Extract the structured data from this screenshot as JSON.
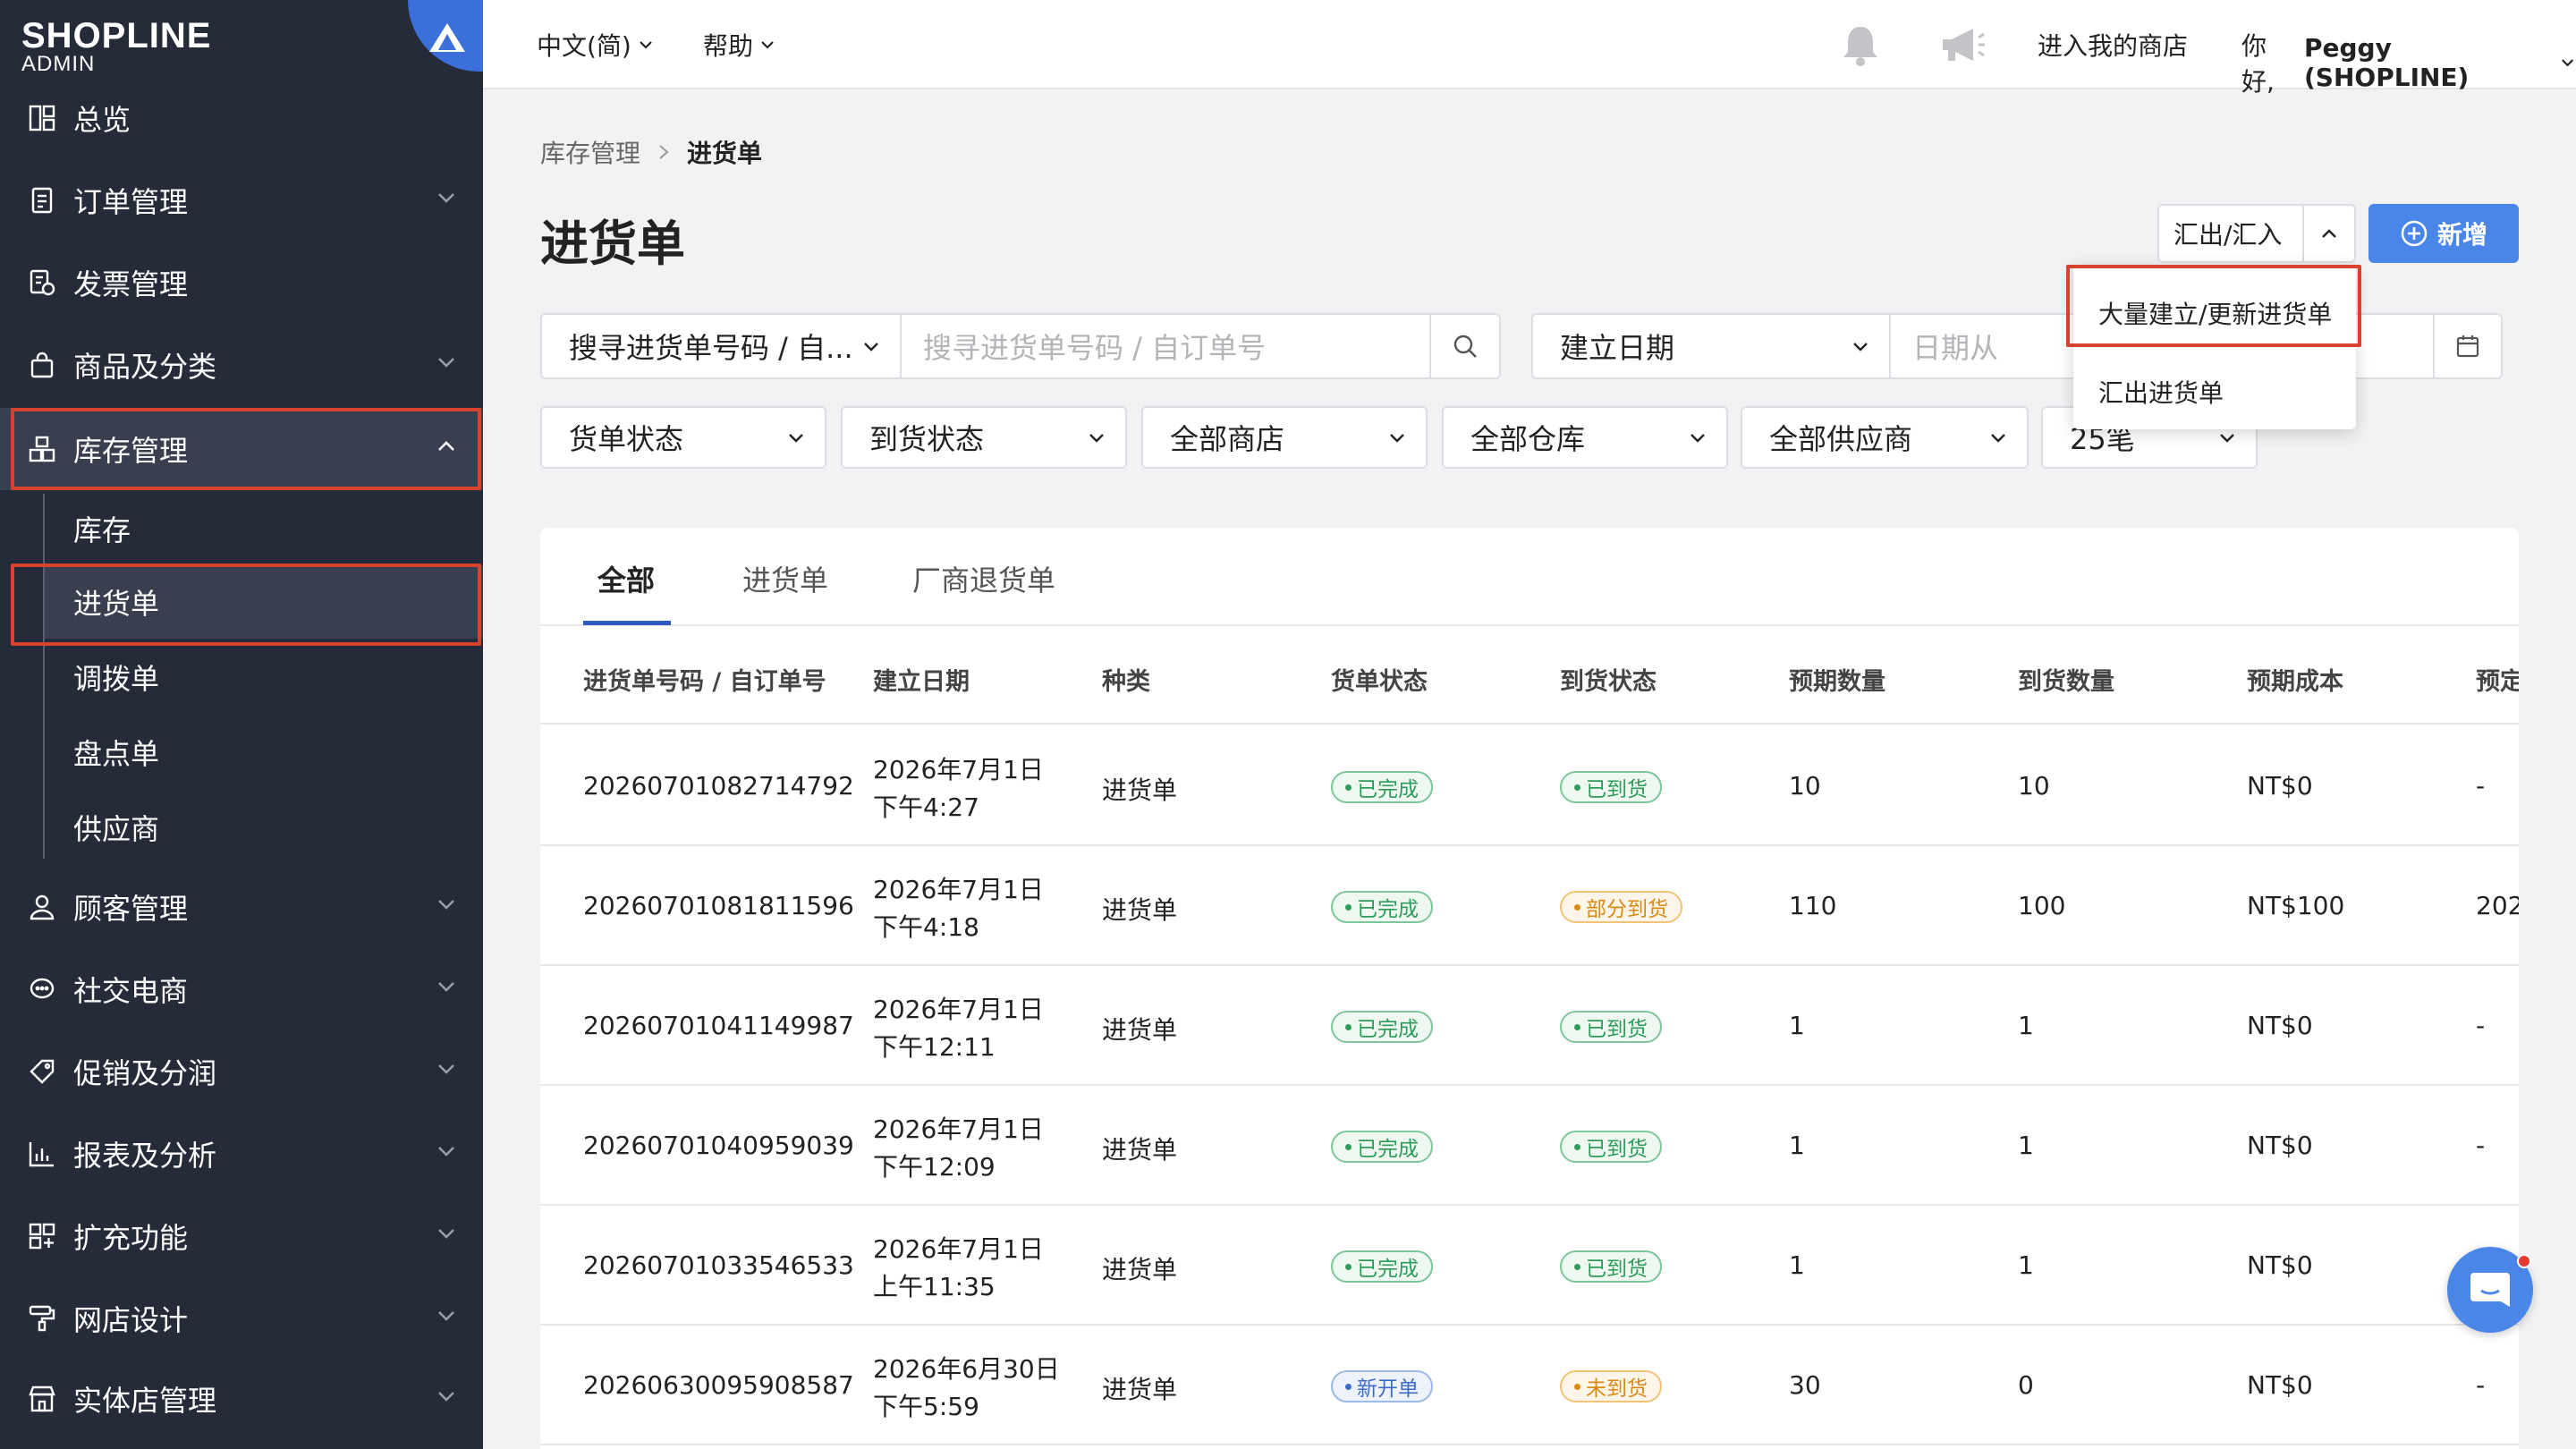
{
  "brand": {
    "name": "SHOPLINE",
    "sub": "ADMIN"
  },
  "sidebar": {
    "items": [
      {
        "label": "总览"
      },
      {
        "label": "订单管理"
      },
      {
        "label": "发票管理"
      },
      {
        "label": "商品及分类"
      },
      {
        "label": "库存管理"
      },
      {
        "label": "顾客管理"
      },
      {
        "label": "社交电商"
      },
      {
        "label": "促销及分润"
      },
      {
        "label": "报表及分析"
      },
      {
        "label": "扩充功能"
      },
      {
        "label": "网店设计"
      },
      {
        "label": "实体店管理"
      }
    ],
    "sub_items": [
      {
        "label": "库存"
      },
      {
        "label": "进货单"
      },
      {
        "label": "调拨单"
      },
      {
        "label": "盘点单"
      },
      {
        "label": "供应商"
      }
    ]
  },
  "topbar": {
    "language": "中文(简)",
    "help": "帮助",
    "enter_store": "进入我的商店",
    "greeting_prefix": "你好,",
    "user": "Peggy (SHOPLINE)"
  },
  "breadcrumb": {
    "parent": "库存管理",
    "current": "进货单"
  },
  "page": {
    "title": "进货单"
  },
  "actions": {
    "export_import": "汇出/汇入",
    "add": "新增"
  },
  "dropdown": {
    "options": [
      "大量建立/更新进货单",
      "汇出进货单"
    ]
  },
  "filters": {
    "search_type": "搜寻进货单号码 / 自...",
    "search_placeholder": "搜寻进货单号码 / 自订单号",
    "date_type": "建立日期",
    "date_from_placeholder": "日期从",
    "order_status": "货单状态",
    "arrival_status": "到货状态",
    "store": "全部商店",
    "warehouse": "全部仓库",
    "supplier": "全部供应商",
    "page_size": "25笔"
  },
  "tabs": [
    "全部",
    "进货单",
    "厂商退货单"
  ],
  "table": {
    "headers": [
      "进货单号码 / 自订单号",
      "建立日期",
      "种类",
      "货单状态",
      "到货状态",
      "预期数量",
      "到货数量",
      "预期成本",
      "预定"
    ],
    "rows": [
      {
        "id": "20260701082714792",
        "date": "2026年7月1日",
        "time": "下午4:27",
        "type": "进货单",
        "status": "已完成",
        "arrival": "已到货",
        "expected_qty": "10",
        "arrived_qty": "10",
        "cost": "NT$0",
        "planned": "-"
      },
      {
        "id": "20260701081811596",
        "date": "2026年7月1日",
        "time": "下午4:18",
        "type": "进货单",
        "status": "已完成",
        "arrival": "部分到货",
        "expected_qty": "110",
        "arrived_qty": "100",
        "cost": "NT$100",
        "planned": "202"
      },
      {
        "id": "20260701041149987",
        "date": "2026年7月1日",
        "time": "下午12:11",
        "type": "进货单",
        "status": "已完成",
        "arrival": "已到货",
        "expected_qty": "1",
        "arrived_qty": "1",
        "cost": "NT$0",
        "planned": "-"
      },
      {
        "id": "20260701040959039",
        "date": "2026年7月1日",
        "time": "下午12:09",
        "type": "进货单",
        "status": "已完成",
        "arrival": "已到货",
        "expected_qty": "1",
        "arrived_qty": "1",
        "cost": "NT$0",
        "planned": "-"
      },
      {
        "id": "20260701033546533",
        "date": "2026年7月1日",
        "time": "上午11:35",
        "type": "进货单",
        "status": "已完成",
        "arrival": "已到货",
        "expected_qty": "1",
        "arrived_qty": "1",
        "cost": "NT$0",
        "planned": ""
      },
      {
        "id": "20260630095908587",
        "date": "2026年6月30日",
        "time": "下午5:59",
        "type": "进货单",
        "status": "新开单",
        "arrival": "未到货",
        "expected_qty": "30",
        "arrived_qty": "0",
        "cost": "NT$0",
        "planned": "-"
      }
    ]
  },
  "colors": {
    "sidebar_bg": "#262b3a",
    "accent": "#4a86e8",
    "highlight": "#d9412f"
  }
}
